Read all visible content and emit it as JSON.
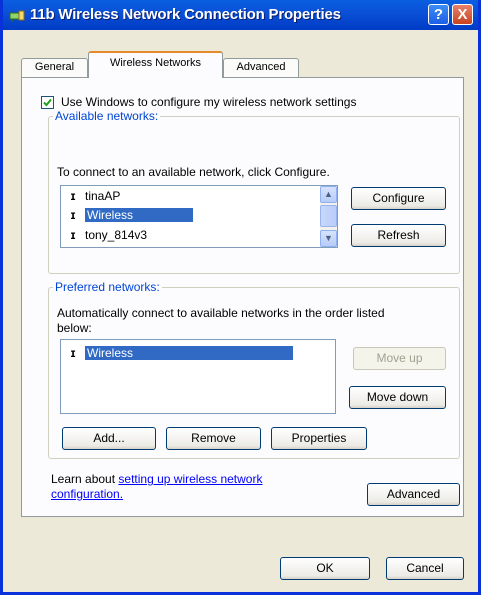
{
  "window": {
    "title": "11b Wireless Network Connection Properties",
    "help": "?",
    "close": "X"
  },
  "tabs": [
    {
      "label": "General"
    },
    {
      "label": "Wireless Networks"
    },
    {
      "label": "Advanced"
    }
  ],
  "use_windows": {
    "label": "Use Windows to configure my wireless network settings",
    "checked": true
  },
  "available": {
    "legend": "Available networks:",
    "instruction": "To connect to an available network, click Configure.",
    "networks": [
      "tinaAP",
      "Wireless",
      "tony_814v3"
    ],
    "selected_index": 1,
    "configure_label": "Configure",
    "refresh_label": "Refresh"
  },
  "preferred": {
    "legend": "Preferred networks:",
    "instruction_line1": "Automatically connect to available networks in the order listed",
    "instruction_line2": "below:",
    "networks": [
      "Wireless"
    ],
    "move_up_label": "Move up",
    "move_down_label": "Move down",
    "add_label": "Add...",
    "remove_label": "Remove",
    "properties_label": "Properties"
  },
  "learn": {
    "prefix": "Learn about",
    "link_line1": "setting up wireless network",
    "link_line2": "configuration."
  },
  "advanced_label": "Advanced",
  "ok_label": "OK",
  "cancel_label": "Cancel",
  "colors": {
    "titlebar": "#0a4fd6",
    "accent_tab": "#e68b2c",
    "legend": "#0046d5",
    "selection": "#316ac5"
  }
}
